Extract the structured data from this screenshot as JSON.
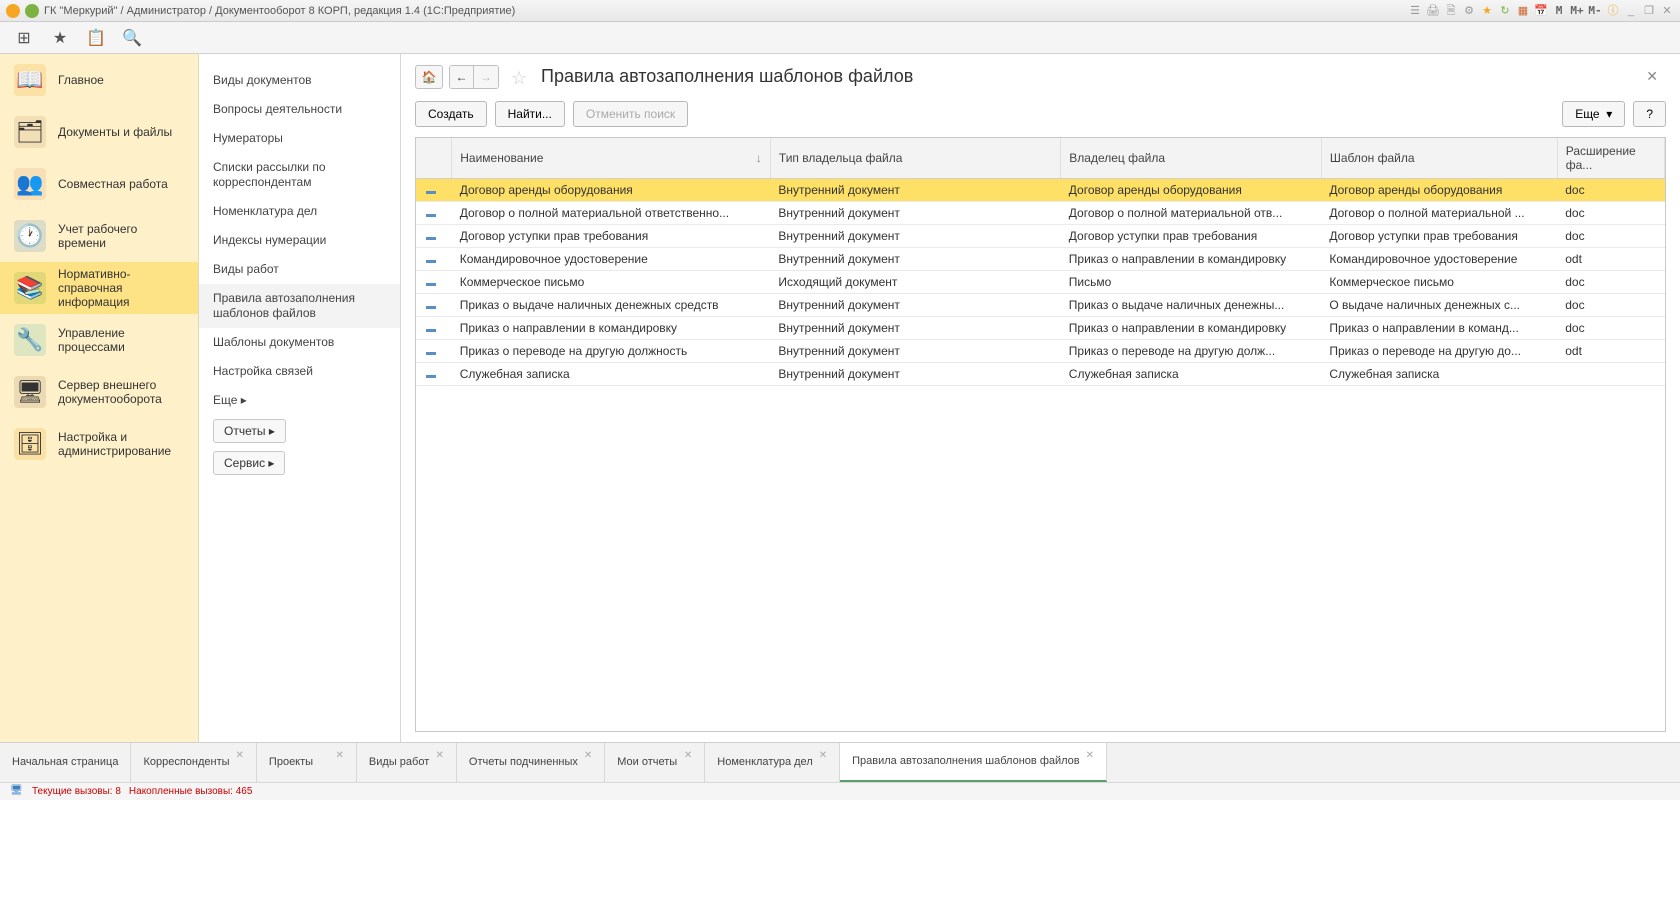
{
  "titlebar": {
    "text": "ГК \"Меркурий\" / Администратор / Документооборот 8 КОРП, редакция 1.4  (1С:Предприятие)",
    "right_labels": [
      "M",
      "M+",
      "M-"
    ]
  },
  "sidebar": {
    "items": [
      {
        "label": "Главное",
        "icon": "📖",
        "bg": "#f5a623"
      },
      {
        "label": "Документы и файлы",
        "icon": "🗂",
        "bg": "#c49a6c"
      },
      {
        "label": "Совместная работа",
        "icon": "👥",
        "bg": "#e59a7a"
      },
      {
        "label": "Учет рабочего времени",
        "icon": "🕐",
        "bg": "#5a8fc4"
      },
      {
        "label": "Нормативно-справочная информация",
        "icon": "📚",
        "bg": "#7cb342"
      },
      {
        "label": "Управление процессами",
        "icon": "🔧",
        "bg": "#5cc0a0"
      },
      {
        "label": "Сервер внешнего документооборота",
        "icon": "🖥",
        "bg": "#a08060"
      },
      {
        "label": "Настройка и администрирование",
        "icon": "🗄",
        "bg": "#f5a623"
      }
    ],
    "selected": 4
  },
  "subnav": {
    "items": [
      "Виды документов",
      "Вопросы деятельности",
      "Нумераторы",
      "Списки рассылки по корреспондентам",
      "Номенклатура дел",
      "Индексы нумерации",
      "Виды работ",
      "Правила автозаполнения шаблонов файлов",
      "Шаблоны документов",
      "Настройка связей",
      "Еще ▸"
    ],
    "active": 7,
    "buttons": [
      "Отчеты ▸",
      "Сервис ▸"
    ]
  },
  "content": {
    "title": "Правила автозаполнения шаблонов файлов",
    "cmd_create": "Создать",
    "cmd_find": "Найти...",
    "cmd_cancel": "Отменить поиск",
    "cmd_more": "Еще",
    "cmd_help": "?"
  },
  "table": {
    "columns": [
      "Наименование",
      "Тип владельца файла",
      "Владелец файла",
      "Шаблон файла",
      "Расширение фа..."
    ],
    "sort_col": 0,
    "rows": [
      {
        "name": "Договор аренды оборудования",
        "type": "Внутренний документ",
        "owner": "Договор аренды оборудования",
        "tmpl": "Договор аренды оборудования",
        "ext": "doc",
        "hl": true
      },
      {
        "name": "Договор о полной материальной ответственно...",
        "type": "Внутренний документ",
        "owner": "Договор о полной материальной отв...",
        "tmpl": "Договор о полной материальной ...",
        "ext": "doc"
      },
      {
        "name": "Договор уступки прав требования",
        "type": "Внутренний документ",
        "owner": "Договор уступки прав требования",
        "tmpl": "Договор уступки прав требования",
        "ext": "doc"
      },
      {
        "name": "Командировочное удостоверение",
        "type": "Внутренний документ",
        "owner": "Приказ о направлении в командировку",
        "tmpl": "Командировочное удостоверение",
        "ext": "odt"
      },
      {
        "name": "Коммерческое письмо",
        "type": "Исходящий документ",
        "owner": "Письмо",
        "tmpl": "Коммерческое письмо",
        "ext": "doc"
      },
      {
        "name": "Приказ о выдаче наличных денежных средств",
        "type": "Внутренний документ",
        "owner": "Приказ о выдаче наличных денежны...",
        "tmpl": "О выдаче наличных денежных с...",
        "ext": "doc"
      },
      {
        "name": "Приказ о направлении в командировку",
        "type": "Внутренний документ",
        "owner": "Приказ о направлении в командировку",
        "tmpl": "Приказ о направлении в команд...",
        "ext": "doc"
      },
      {
        "name": "Приказ о переводе на другую должность",
        "type": "Внутренний документ",
        "owner": "Приказ о переводе на другую долж...",
        "tmpl": "Приказ о переводе на другую до...",
        "ext": "odt"
      },
      {
        "name": "Служебная записка",
        "type": "Внутренний документ",
        "owner": "Служебная записка",
        "tmpl": "Служебная записка",
        "ext": ""
      }
    ]
  },
  "bottom_tabs": [
    {
      "label": "Начальная страница",
      "closable": false
    },
    {
      "label": "Корреспонденты",
      "closable": true
    },
    {
      "label": "Проекты",
      "closable": true
    },
    {
      "label": "Виды работ",
      "closable": true
    },
    {
      "label": "Отчеты подчиненных",
      "closable": true
    },
    {
      "label": "Мои отчеты",
      "closable": true
    },
    {
      "label": "Номенклатура дел",
      "closable": true
    },
    {
      "label": "Правила автозаполнения шаблонов файлов",
      "closable": true,
      "active": true
    }
  ],
  "status": {
    "calls": "Текущие вызовы: 8",
    "accum": "Накопленные вызовы: 465"
  }
}
